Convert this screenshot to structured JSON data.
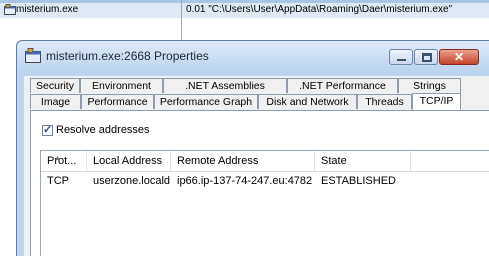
{
  "background_row": {
    "process_name": "misterium.exe",
    "command_line": "0.01  \"C:\\Users\\User\\AppData\\Roaming\\Daer\\misterium.exe\"",
    "icon": "process-icon"
  },
  "window": {
    "title": "misterium.exe:2668 Properties",
    "icon": "process-icon",
    "caption_buttons": {
      "minimize": "minimize",
      "maximize": "maximize",
      "close": "✕"
    }
  },
  "tabs": {
    "row1": [
      "Security",
      "Environment",
      ".NET Assemblies",
      ".NET Performance",
      "Strings"
    ],
    "row2": [
      "Image",
      "Performance",
      "Performance Graph",
      "Disk and Network",
      "Threads",
      "TCP/IP"
    ],
    "active": "TCP/IP"
  },
  "resolve_addresses": {
    "label": "Resolve addresses",
    "checked": true
  },
  "connections": {
    "columns": [
      "Prot...",
      "Local Address",
      "Remote Address",
      "State"
    ],
    "rows": [
      {
        "protocol": "TCP",
        "local": "userzone.locald...",
        "remote": "ip66.ip-137-74-247.eu:4782",
        "state": "ESTABLISHED"
      }
    ]
  },
  "colors": {
    "accent": "#bcd4ee",
    "selection_row": "#dfe9f6",
    "close_button": "#c7432b"
  }
}
